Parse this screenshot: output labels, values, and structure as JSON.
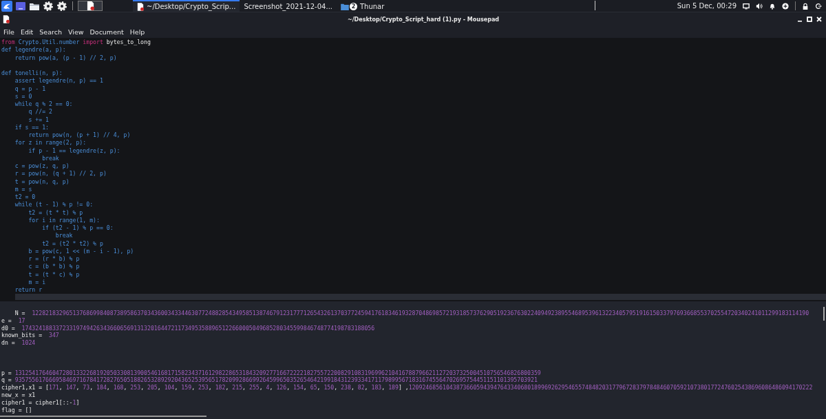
{
  "panel": {
    "tasks": [
      {
        "label": "~/Desktop/Crypto_Scrip...",
        "selected": true
      },
      {
        "label": "Screenshot_2021-12-04...",
        "selected": false
      },
      {
        "label": "Thunar",
        "badge": "2",
        "selected": false
      }
    ],
    "clock": "Sun 5 Dec, 00:29"
  },
  "window": {
    "title": "~/Desktop/Crypto_Script_hard (1).py - Mousepad"
  },
  "menu": [
    "File",
    "Edit",
    "Search",
    "View",
    "Document",
    "Help"
  ],
  "editor": {
    "top_lines": [
      {
        "kind": "code",
        "tokens": [
          {
            "kind": "keyword",
            "text": "from"
          },
          {
            "kind": "code",
            "text": " Crypto.Util.number "
          },
          {
            "kind": "keyword",
            "text": "import"
          },
          {
            "kind": "name",
            "text": " bytes_to_long"
          }
        ]
      },
      {
        "kind": "code",
        "tokens": [
          {
            "kind": "code",
            "text": "def legendre(a, p):"
          }
        ]
      },
      {
        "kind": "code",
        "tokens": [
          {
            "kind": "code",
            "text": "    return pow(a, (p - 1) // 2, p)"
          }
        ]
      },
      {
        "kind": "blank"
      },
      {
        "kind": "code",
        "tokens": [
          {
            "kind": "code",
            "text": "def tonelli(n, p):"
          }
        ]
      },
      {
        "kind": "code",
        "tokens": [
          {
            "kind": "code",
            "text": "    assert legendre(n, p) == 1"
          }
        ]
      },
      {
        "kind": "code",
        "tokens": [
          {
            "kind": "code",
            "text": "    q = p - 1"
          }
        ]
      },
      {
        "kind": "code",
        "tokens": [
          {
            "kind": "code",
            "text": "    s = 0"
          }
        ]
      },
      {
        "kind": "code",
        "tokens": [
          {
            "kind": "code",
            "text": "    while q % 2 == 0:"
          }
        ]
      },
      {
        "kind": "code",
        "tokens": [
          {
            "kind": "code",
            "text": "        q //= 2"
          }
        ]
      },
      {
        "kind": "code",
        "tokens": [
          {
            "kind": "code",
            "text": "        s += 1"
          }
        ]
      },
      {
        "kind": "code",
        "tokens": [
          {
            "kind": "code",
            "text": "    if s == 1:"
          }
        ]
      },
      {
        "kind": "code",
        "tokens": [
          {
            "kind": "code",
            "text": "        return pow(n, (p + 1) // 4, p)"
          }
        ]
      },
      {
        "kind": "code",
        "tokens": [
          {
            "kind": "code",
            "text": "    for z in range(2, p):"
          }
        ]
      },
      {
        "kind": "code",
        "tokens": [
          {
            "kind": "code",
            "text": "        if p - 1 == legendre(z, p):"
          }
        ]
      },
      {
        "kind": "code",
        "tokens": [
          {
            "kind": "code",
            "text": "            break"
          }
        ]
      },
      {
        "kind": "code",
        "tokens": [
          {
            "kind": "code",
            "text": "    c = pow(z, q, p)"
          }
        ]
      },
      {
        "kind": "code",
        "tokens": [
          {
            "kind": "code",
            "text": "    r = pow(n, (q + 1) // 2, p)"
          }
        ]
      },
      {
        "kind": "code",
        "tokens": [
          {
            "kind": "code",
            "text": "    t = pow(n, q, p)"
          }
        ]
      },
      {
        "kind": "code",
        "tokens": [
          {
            "kind": "code",
            "text": "    m = s"
          }
        ]
      },
      {
        "kind": "code",
        "tokens": [
          {
            "kind": "code",
            "text": "    t2 = 0"
          }
        ]
      },
      {
        "kind": "code",
        "tokens": [
          {
            "kind": "code",
            "text": "    while (t - 1) % p != 0:"
          }
        ]
      },
      {
        "kind": "code",
        "tokens": [
          {
            "kind": "code",
            "text": "        t2 = (t * t) % p"
          }
        ]
      },
      {
        "kind": "code",
        "tokens": [
          {
            "kind": "code",
            "text": "        for i in range(1, m):"
          }
        ]
      },
      {
        "kind": "code",
        "tokens": [
          {
            "kind": "code",
            "text": "            if (t2 - 1) % p == 0:"
          }
        ]
      },
      {
        "kind": "code",
        "tokens": [
          {
            "kind": "code",
            "text": "                break"
          }
        ]
      },
      {
        "kind": "code",
        "tokens": [
          {
            "kind": "code",
            "text": "            t2 = (t2 * t2) % p"
          }
        ]
      },
      {
        "kind": "code",
        "tokens": [
          {
            "kind": "code",
            "text": "        b = pow(c, 1 << (m - i - 1), p)"
          }
        ]
      },
      {
        "kind": "code",
        "tokens": [
          {
            "kind": "code",
            "text": "        r = (r * b) % p"
          }
        ]
      },
      {
        "kind": "code",
        "tokens": [
          {
            "kind": "code",
            "text": "        c = (b * b) % p"
          }
        ]
      },
      {
        "kind": "code",
        "tokens": [
          {
            "kind": "code",
            "text": "        t = (t * c) % p"
          }
        ]
      },
      {
        "kind": "code",
        "tokens": [
          {
            "kind": "code",
            "text": "        m = i"
          }
        ]
      },
      {
        "kind": "code",
        "tokens": [
          {
            "kind": "code",
            "text": "    return r"
          }
        ]
      }
    ],
    "bottom_lines": [
      {
        "kind": "blank"
      },
      {
        "kind": "code",
        "tokens": [
          {
            "kind": "name",
            "text": "    N =  "
          },
          {
            "kind": "number",
            "text": "1228218329651376869984087389586370343600343344630772488285434958513874679123177712654326137037724594176183461932870486985721931857376290519236763022409492389554689539613223405795191615033797693668553702554720340241011299183114190"
          }
        ]
      },
      {
        "kind": "code",
        "tokens": [
          {
            "kind": "name",
            "text": "e =  "
          },
          {
            "kind": "number",
            "text": "17"
          }
        ]
      },
      {
        "kind": "code",
        "tokens": [
          {
            "kind": "name",
            "text": "d0 =  "
          },
          {
            "kind": "number",
            "text": "17432418833723319749426343660656913132016447211734953588965122660005049685280345599846748774198783188056"
          }
        ]
      },
      {
        "kind": "code",
        "tokens": [
          {
            "kind": "name",
            "text": "known_bits =  "
          },
          {
            "kind": "number",
            "text": "347"
          }
        ]
      },
      {
        "kind": "code",
        "tokens": [
          {
            "kind": "name",
            "text": "dn =  "
          },
          {
            "kind": "number",
            "text": "1024"
          }
        ]
      },
      {
        "kind": "blank"
      },
      {
        "kind": "blank"
      },
      {
        "kind": "blank"
      },
      {
        "kind": "code",
        "tokens": [
          {
            "kind": "name",
            "text": "p = "
          },
          {
            "kind": "number",
            "text": "13125417646047280133226819205033081390054616817158234371612982286531843209277166722221827557220082910831969962104167887966211272037325004510756546826800359"
          }
        ]
      },
      {
        "kind": "code",
        "tokens": [
          {
            "kind": "name",
            "text": "q = "
          },
          {
            "kind": "number",
            "text": "9357556176669584697167841728276505188265328929204365253956517820992866992645996503526546421991843123933417117989956718316745564702695754451151101395703921"
          }
        ]
      },
      {
        "kind": "code",
        "tokens": [
          {
            "kind": "name",
            "text": "cipher1,x1 = ["
          },
          {
            "kind": "number",
            "text": "171"
          },
          {
            "kind": "name",
            "text": ", "
          },
          {
            "kind": "number",
            "text": "147"
          },
          {
            "kind": "name",
            "text": ", "
          },
          {
            "kind": "number",
            "text": "73"
          },
          {
            "kind": "name",
            "text": ", "
          },
          {
            "kind": "number",
            "text": "184"
          },
          {
            "kind": "name",
            "text": ", "
          },
          {
            "kind": "number",
            "text": "168"
          },
          {
            "kind": "name",
            "text": ", "
          },
          {
            "kind": "number",
            "text": "253"
          },
          {
            "kind": "name",
            "text": ", "
          },
          {
            "kind": "number",
            "text": "205"
          },
          {
            "kind": "name",
            "text": ", "
          },
          {
            "kind": "number",
            "text": "104"
          },
          {
            "kind": "name",
            "text": ", "
          },
          {
            "kind": "number",
            "text": "159"
          },
          {
            "kind": "name",
            "text": ", "
          },
          {
            "kind": "number",
            "text": "253"
          },
          {
            "kind": "name",
            "text": ", "
          },
          {
            "kind": "number",
            "text": "182"
          },
          {
            "kind": "name",
            "text": ", "
          },
          {
            "kind": "number",
            "text": "215"
          },
          {
            "kind": "name",
            "text": ", "
          },
          {
            "kind": "number",
            "text": "255"
          },
          {
            "kind": "name",
            "text": ", "
          },
          {
            "kind": "number",
            "text": "4"
          },
          {
            "kind": "name",
            "text": ", "
          },
          {
            "kind": "number",
            "text": "126"
          },
          {
            "kind": "name",
            "text": ", "
          },
          {
            "kind": "number",
            "text": "154"
          },
          {
            "kind": "name",
            "text": ", "
          },
          {
            "kind": "number",
            "text": "65"
          },
          {
            "kind": "name",
            "text": ", "
          },
          {
            "kind": "number",
            "text": "150"
          },
          {
            "kind": "name",
            "text": ", "
          },
          {
            "kind": "number",
            "text": "238"
          },
          {
            "kind": "name",
            "text": ", "
          },
          {
            "kind": "number",
            "text": "82"
          },
          {
            "kind": "name",
            "text": ", "
          },
          {
            "kind": "number",
            "text": "183"
          },
          {
            "kind": "name",
            "text": ", "
          },
          {
            "kind": "number",
            "text": "189"
          },
          {
            "kind": "name",
            "text": "] ,"
          },
          {
            "kind": "number",
            "text": "12092468561043873660594394764334068018996926295465574848203177967283797848460705921073801772476025438696086486094170222"
          }
        ]
      },
      {
        "kind": "code",
        "tokens": [
          {
            "kind": "name",
            "text": "new_x = x1"
          }
        ]
      },
      {
        "kind": "code",
        "tokens": [
          {
            "kind": "name",
            "text": "cipher1 = cipher1[::-"
          },
          {
            "kind": "number",
            "text": "1"
          },
          {
            "kind": "name",
            "text": "]"
          }
        ]
      },
      {
        "kind": "code",
        "tokens": [
          {
            "kind": "name",
            "text": "flag = []"
          }
        ]
      }
    ]
  }
}
